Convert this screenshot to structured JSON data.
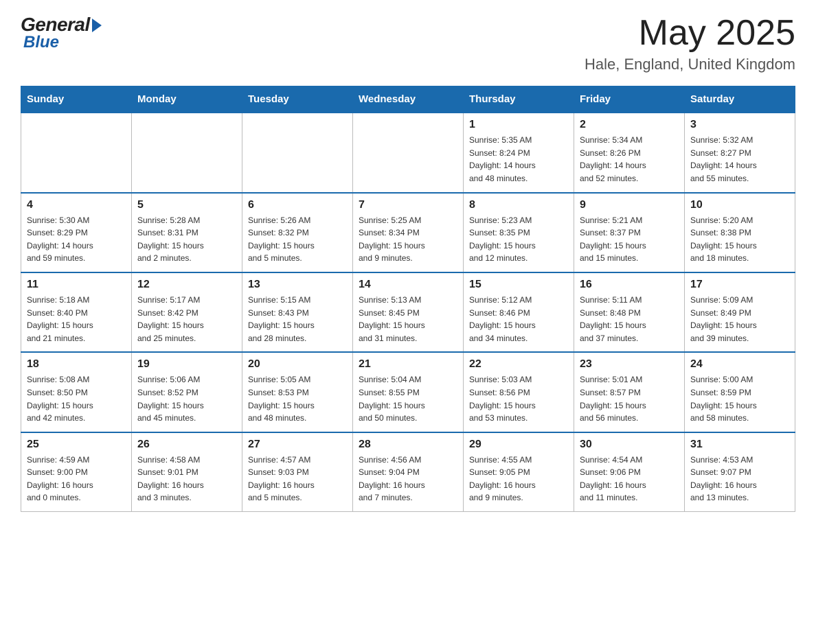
{
  "logo": {
    "general": "General",
    "blue": "Blue"
  },
  "title": "May 2025",
  "location": "Hale, England, United Kingdom",
  "days_of_week": [
    "Sunday",
    "Monday",
    "Tuesday",
    "Wednesday",
    "Thursday",
    "Friday",
    "Saturday"
  ],
  "weeks": [
    [
      {
        "day": "",
        "info": ""
      },
      {
        "day": "",
        "info": ""
      },
      {
        "day": "",
        "info": ""
      },
      {
        "day": "",
        "info": ""
      },
      {
        "day": "1",
        "info": "Sunrise: 5:35 AM\nSunset: 8:24 PM\nDaylight: 14 hours\nand 48 minutes."
      },
      {
        "day": "2",
        "info": "Sunrise: 5:34 AM\nSunset: 8:26 PM\nDaylight: 14 hours\nand 52 minutes."
      },
      {
        "day": "3",
        "info": "Sunrise: 5:32 AM\nSunset: 8:27 PM\nDaylight: 14 hours\nand 55 minutes."
      }
    ],
    [
      {
        "day": "4",
        "info": "Sunrise: 5:30 AM\nSunset: 8:29 PM\nDaylight: 14 hours\nand 59 minutes."
      },
      {
        "day": "5",
        "info": "Sunrise: 5:28 AM\nSunset: 8:31 PM\nDaylight: 15 hours\nand 2 minutes."
      },
      {
        "day": "6",
        "info": "Sunrise: 5:26 AM\nSunset: 8:32 PM\nDaylight: 15 hours\nand 5 minutes."
      },
      {
        "day": "7",
        "info": "Sunrise: 5:25 AM\nSunset: 8:34 PM\nDaylight: 15 hours\nand 9 minutes."
      },
      {
        "day": "8",
        "info": "Sunrise: 5:23 AM\nSunset: 8:35 PM\nDaylight: 15 hours\nand 12 minutes."
      },
      {
        "day": "9",
        "info": "Sunrise: 5:21 AM\nSunset: 8:37 PM\nDaylight: 15 hours\nand 15 minutes."
      },
      {
        "day": "10",
        "info": "Sunrise: 5:20 AM\nSunset: 8:38 PM\nDaylight: 15 hours\nand 18 minutes."
      }
    ],
    [
      {
        "day": "11",
        "info": "Sunrise: 5:18 AM\nSunset: 8:40 PM\nDaylight: 15 hours\nand 21 minutes."
      },
      {
        "day": "12",
        "info": "Sunrise: 5:17 AM\nSunset: 8:42 PM\nDaylight: 15 hours\nand 25 minutes."
      },
      {
        "day": "13",
        "info": "Sunrise: 5:15 AM\nSunset: 8:43 PM\nDaylight: 15 hours\nand 28 minutes."
      },
      {
        "day": "14",
        "info": "Sunrise: 5:13 AM\nSunset: 8:45 PM\nDaylight: 15 hours\nand 31 minutes."
      },
      {
        "day": "15",
        "info": "Sunrise: 5:12 AM\nSunset: 8:46 PM\nDaylight: 15 hours\nand 34 minutes."
      },
      {
        "day": "16",
        "info": "Sunrise: 5:11 AM\nSunset: 8:48 PM\nDaylight: 15 hours\nand 37 minutes."
      },
      {
        "day": "17",
        "info": "Sunrise: 5:09 AM\nSunset: 8:49 PM\nDaylight: 15 hours\nand 39 minutes."
      }
    ],
    [
      {
        "day": "18",
        "info": "Sunrise: 5:08 AM\nSunset: 8:50 PM\nDaylight: 15 hours\nand 42 minutes."
      },
      {
        "day": "19",
        "info": "Sunrise: 5:06 AM\nSunset: 8:52 PM\nDaylight: 15 hours\nand 45 minutes."
      },
      {
        "day": "20",
        "info": "Sunrise: 5:05 AM\nSunset: 8:53 PM\nDaylight: 15 hours\nand 48 minutes."
      },
      {
        "day": "21",
        "info": "Sunrise: 5:04 AM\nSunset: 8:55 PM\nDaylight: 15 hours\nand 50 minutes."
      },
      {
        "day": "22",
        "info": "Sunrise: 5:03 AM\nSunset: 8:56 PM\nDaylight: 15 hours\nand 53 minutes."
      },
      {
        "day": "23",
        "info": "Sunrise: 5:01 AM\nSunset: 8:57 PM\nDaylight: 15 hours\nand 56 minutes."
      },
      {
        "day": "24",
        "info": "Sunrise: 5:00 AM\nSunset: 8:59 PM\nDaylight: 15 hours\nand 58 minutes."
      }
    ],
    [
      {
        "day": "25",
        "info": "Sunrise: 4:59 AM\nSunset: 9:00 PM\nDaylight: 16 hours\nand 0 minutes."
      },
      {
        "day": "26",
        "info": "Sunrise: 4:58 AM\nSunset: 9:01 PM\nDaylight: 16 hours\nand 3 minutes."
      },
      {
        "day": "27",
        "info": "Sunrise: 4:57 AM\nSunset: 9:03 PM\nDaylight: 16 hours\nand 5 minutes."
      },
      {
        "day": "28",
        "info": "Sunrise: 4:56 AM\nSunset: 9:04 PM\nDaylight: 16 hours\nand 7 minutes."
      },
      {
        "day": "29",
        "info": "Sunrise: 4:55 AM\nSunset: 9:05 PM\nDaylight: 16 hours\nand 9 minutes."
      },
      {
        "day": "30",
        "info": "Sunrise: 4:54 AM\nSunset: 9:06 PM\nDaylight: 16 hours\nand 11 minutes."
      },
      {
        "day": "31",
        "info": "Sunrise: 4:53 AM\nSunset: 9:07 PM\nDaylight: 16 hours\nand 13 minutes."
      }
    ]
  ]
}
